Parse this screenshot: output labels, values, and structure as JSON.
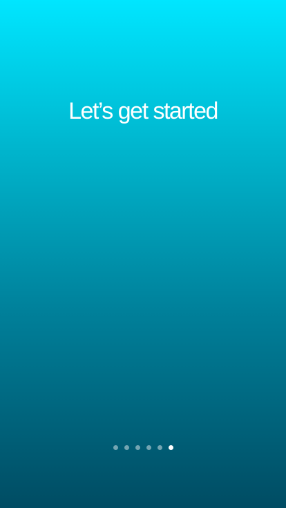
{
  "onboarding": {
    "title": "Let’s get started",
    "page_indicator": {
      "total_pages": 6,
      "current_page": 6
    }
  },
  "colors": {
    "gradient_top": "#00e6ff",
    "gradient_bottom": "#004c63",
    "text": "#ffffff",
    "dot_inactive": "rgba(255,255,255,0.45)",
    "dot_active": "#ffffff"
  }
}
